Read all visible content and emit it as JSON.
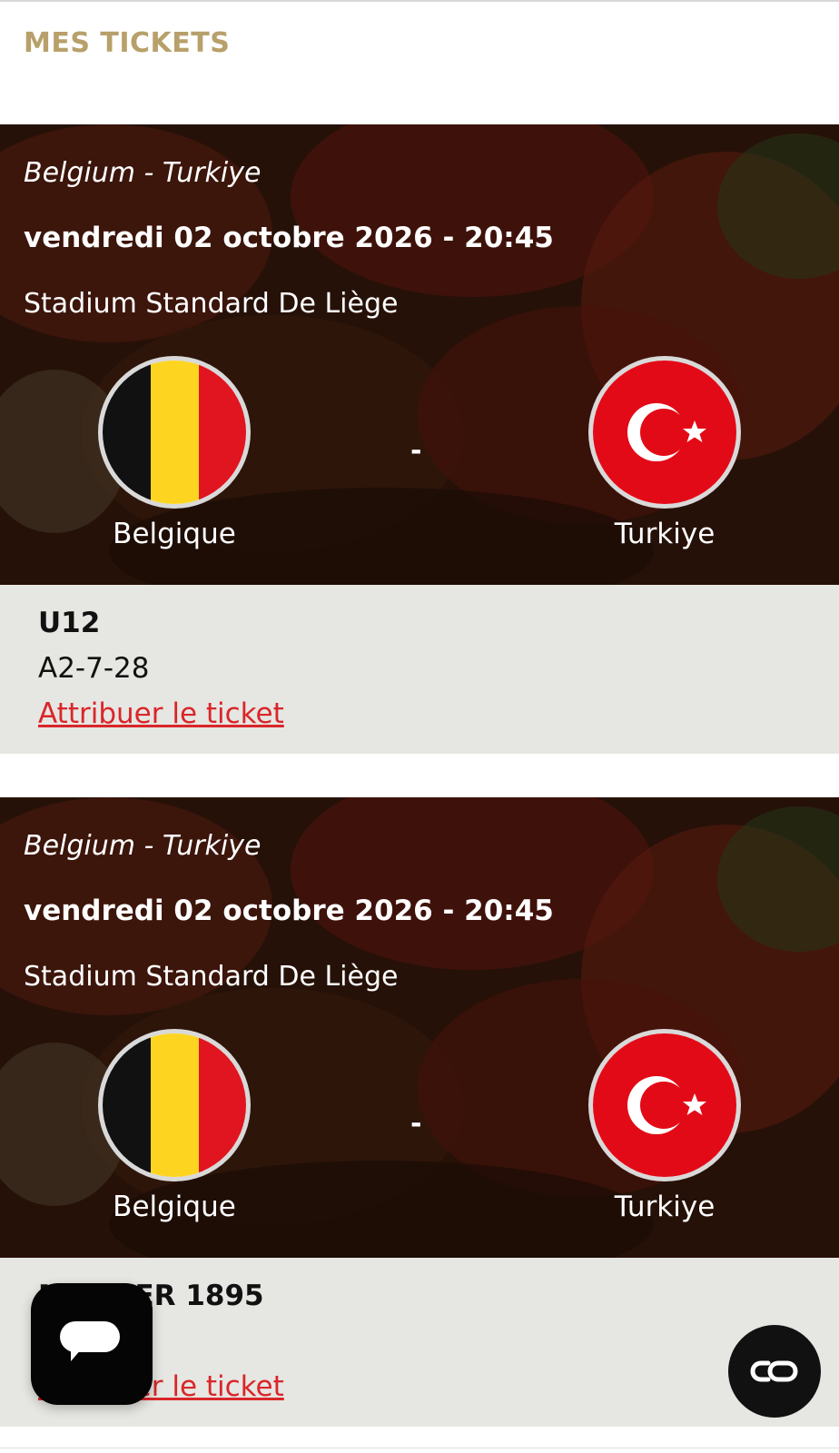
{
  "header": {
    "title": "MES TICKETS"
  },
  "tickets": [
    {
      "match_name": "Belgium - Turkiye",
      "date": "vendredi 02 octobre 2026 - 20:45",
      "venue": "Stadium Standard De Liège",
      "home_team": "Belgique",
      "away_team": "Turkiye",
      "separator": "-",
      "category": "U12",
      "seat": "A2-7-28",
      "assign_label": "Attribuer le ticket"
    },
    {
      "match_name": "Belgium - Turkiye",
      "date": "vendredi 02 octobre 2026 - 20:45",
      "venue": "Stadium Standard De Liège",
      "home_team": "Belgique",
      "away_team": "Turkiye",
      "separator": "-",
      "category": "MEMBER 1895",
      "seat": "",
      "assign_label": "Attribuer le ticket"
    }
  ],
  "floating": {
    "chat_icon": "chat-bubble-icon",
    "co_icon": "co-logo-icon"
  },
  "colors": {
    "header_title": "#b8a06a",
    "link": "#d9262a",
    "info_background": "#e6e6e2",
    "belgium_black": "#111111",
    "belgium_yellow": "#fdd520",
    "belgium_red": "#e0151f",
    "turkey_red": "#e30a17"
  }
}
